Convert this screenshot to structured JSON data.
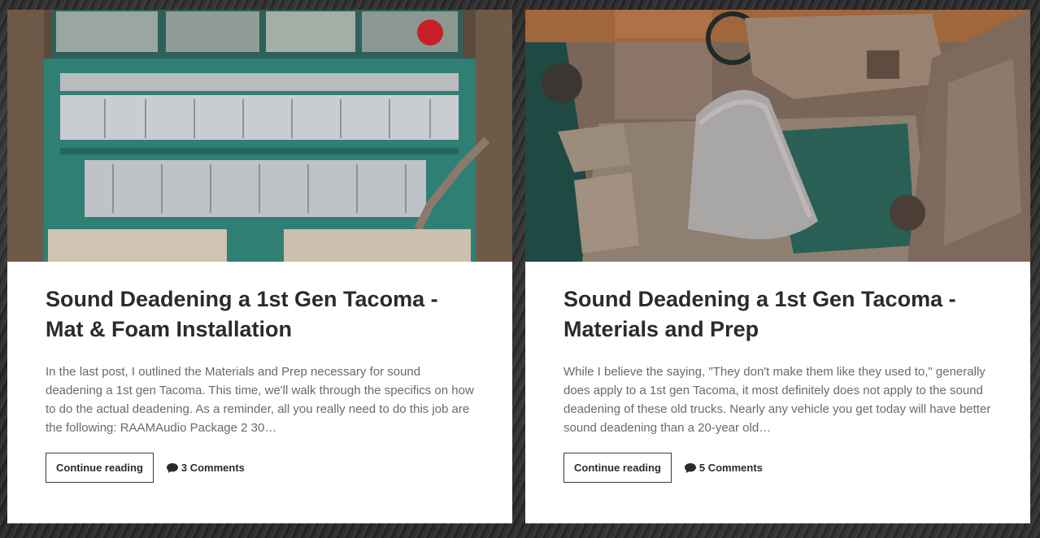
{
  "posts": [
    {
      "title": "Sound Deadening a 1st Gen Tacoma - Mat & Foam Installation",
      "excerpt": "In the last post, I outlined the Materials and Prep necessary for sound deadening a 1st gen Tacoma. This time, we'll walk through the specifics on how to do the actual deadening. As a reminder, all you really need to do this job are the following: RAAMAudio Package 2 30…",
      "continue_label": "Continue reading",
      "comments_label": "3 Comments",
      "comments_icon": "speech-bubble-icon"
    },
    {
      "title": "Sound Deadening a 1st Gen Tacoma - Materials and Prep",
      "excerpt": "While I believe the saying, \"They don't make them like they used to,\" generally does apply to a 1st gen Tacoma, it most definitely does not apply to the sound deadening of these old trucks. Nearly any vehicle you get today will have better sound deadening than a 20-year old…",
      "continue_label": "Continue reading",
      "comments_label": "5 Comments",
      "comments_icon": "speech-bubble-icon"
    }
  ]
}
